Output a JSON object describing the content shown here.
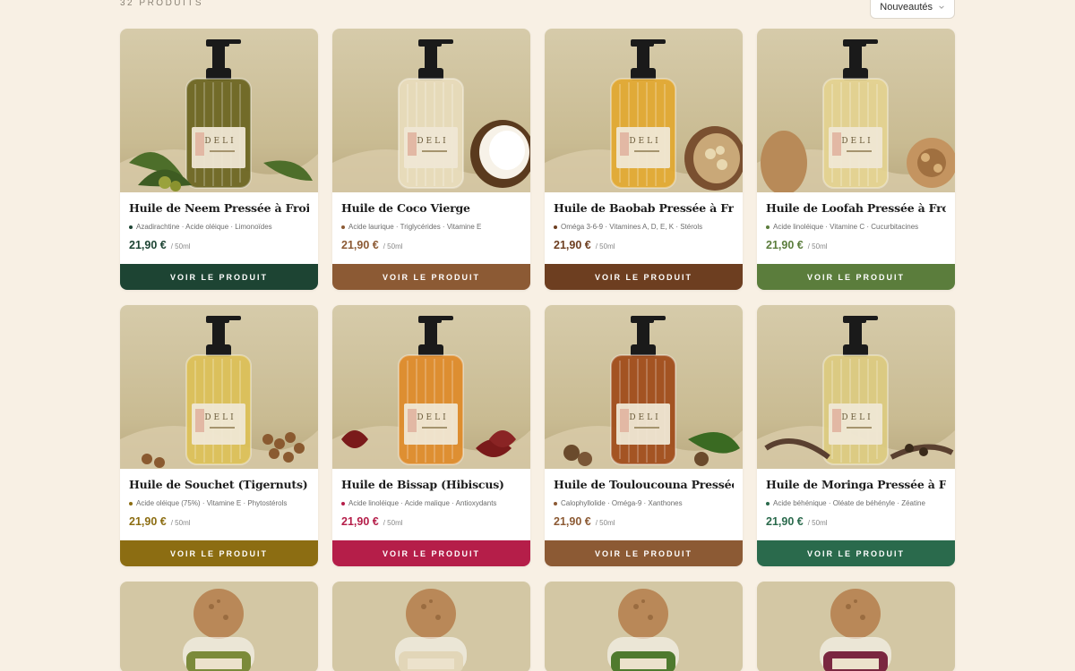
{
  "header": {
    "count_label": "32 PRODUITS",
    "sort": {
      "selected": "Nouveautés"
    }
  },
  "products": [
    {
      "name": "Huile de Neem Pressée à Froid",
      "tags": "Azadirachtine · Acide oléique · Limonoïdes",
      "price": "21,90 €",
      "unit": "/ 50ml",
      "cta": "VOIR LE PRODUIT",
      "accent": "#1d4433",
      "oil_color": "#6a6420",
      "prop": "leaves"
    },
    {
      "name": "Huile de Coco Vierge",
      "tags": "Acide laurique · Triglycérides · Vitamine E",
      "price": "21,90 €",
      "unit": "/ 50ml",
      "cta": "VOIR LE PRODUIT",
      "accent": "#8c5a34",
      "oil_color": "#e8dcbc",
      "prop": "coconut"
    },
    {
      "name": "Huile de Baobab Pressée à Froid",
      "tags": "Oméga 3-6-9 · Vitamines A, D, E, K · Stérols",
      "price": "21,90 €",
      "unit": "/ 50ml",
      "cta": "VOIR LE PRODUIT",
      "accent": "#6d3e20",
      "oil_color": "#e2a830",
      "prop": "baobab"
    },
    {
      "name": "Huile de Loofah Pressée à Froid",
      "tags": "Acide linoléique · Vitamine C · Cucurbitacines",
      "price": "21,90 €",
      "unit": "/ 50ml",
      "cta": "VOIR LE PRODUIT",
      "accent": "#5b7d3c",
      "oil_color": "#e4d290",
      "prop": "loofah"
    },
    {
      "name": "Huile de Souchet (Tigernuts)",
      "tags": "Acide oléique (75%) · Vitamine E · Phytostérols",
      "price": "21,90 €",
      "unit": "/ 50ml",
      "cta": "VOIR LE PRODUIT",
      "accent": "#8c6d12",
      "oil_color": "#dcc057",
      "prop": "nuts"
    },
    {
      "name": "Huile de Bissap (Hibiscus)",
      "tags": "Acide linoléique · Acide malique · Antioxydants",
      "price": "21,90 €",
      "unit": "/ 50ml",
      "cta": "VOIR LE PRODUIT",
      "accent": "#b51e49",
      "oil_color": "#de8a28",
      "prop": "hibiscus"
    },
    {
      "name": "Huile de Touloucouna Pressée à Froid",
      "tags": "Calophyllolide · Oméga-9 · Xanthones",
      "price": "21,90 €",
      "unit": "/ 50ml",
      "cta": "VOIR LE PRODUIT",
      "accent": "#8c5a34",
      "oil_color": "#a04a18",
      "prop": "seeds"
    },
    {
      "name": "Huile de Moringa Pressée à Froid",
      "tags": "Acide béhénique · Oléate de béhényle · Zéatine",
      "price": "21,90 €",
      "unit": "/ 50ml",
      "cta": "VOIR LE PRODUIT",
      "accent": "#2a6a4c",
      "oil_color": "#dccb80",
      "prop": "pods"
    }
  ],
  "partial_row": [
    {
      "powder_color": "#7b8a3a"
    },
    {
      "powder_color": "#e2d6b8"
    },
    {
      "powder_color": "#4f7a2e"
    },
    {
      "powder_color": "#7a2740"
    }
  ]
}
